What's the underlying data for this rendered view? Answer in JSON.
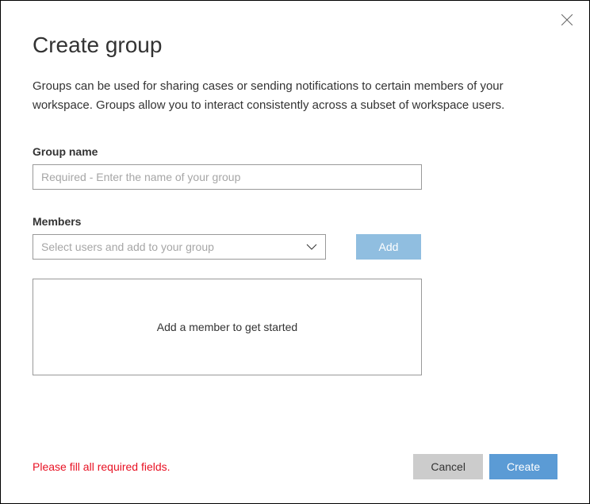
{
  "dialog": {
    "title": "Create group",
    "description": "Groups can be used for sharing cases or sending notifications to certain members of your workspace. Groups allow you to interact consistently across a subset of workspace users."
  },
  "groupName": {
    "label": "Group name",
    "placeholder": "Required - Enter the name of your group",
    "value": ""
  },
  "members": {
    "label": "Members",
    "selectPlaceholder": "Select users and add to your group",
    "addButton": "Add",
    "emptyMessage": "Add a member to get started"
  },
  "footer": {
    "error": "Please fill all required fields.",
    "cancel": "Cancel",
    "create": "Create"
  }
}
